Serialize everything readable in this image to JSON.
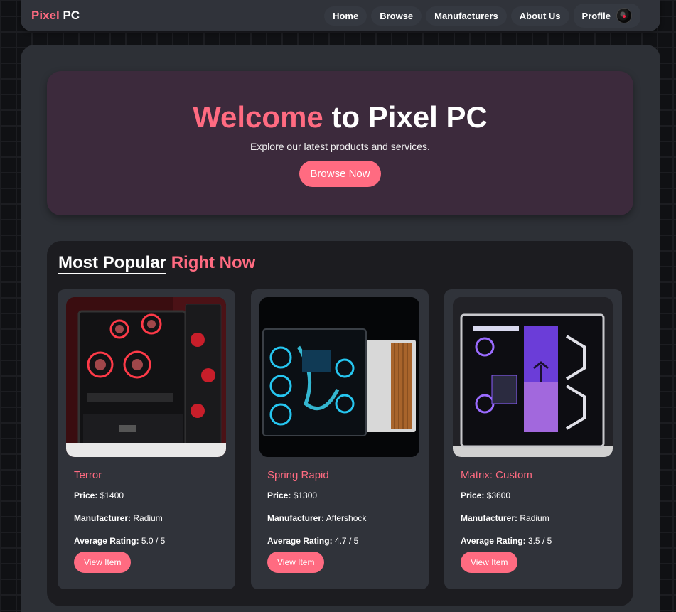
{
  "brand": {
    "part1": "Pixel",
    "part2": "PC"
  },
  "nav": {
    "links": [
      "Home",
      "Browse",
      "Manufacturers",
      "About Us"
    ],
    "profile_label": "Profile"
  },
  "hero": {
    "title_accent": "Welcome",
    "title_rest": " to Pixel PC",
    "subtitle": "Explore our latest products and services.",
    "cta": "Browse Now"
  },
  "popular": {
    "title_part1": "Most Popular",
    "title_part2": "Right Now",
    "cards": [
      {
        "name": "Terror",
        "price_label": "Price:",
        "price": "$1400",
        "manufacturer_label": "Manufacturer:",
        "manufacturer": "Radium",
        "rating_label": "Average Rating:",
        "rating": "5.0 / 5",
        "button": "View Item",
        "image_icon": "red-gaming-pc-image"
      },
      {
        "name": "Spring Rapid",
        "price_label": "Price:",
        "price": "$1300",
        "manufacturer_label": "Manufacturer:",
        "manufacturer": "Aftershock",
        "rating_label": "Average Rating:",
        "rating": "4.7 / 5",
        "button": "View Item",
        "image_icon": "blue-gaming-pc-image"
      },
      {
        "name": "Matrix: Custom",
        "price_label": "Price:",
        "price": "$3600",
        "manufacturer_label": "Manufacturer:",
        "manufacturer": "Radium",
        "rating_label": "Average Rating:",
        "rating": "3.5 / 5",
        "button": "View Item",
        "image_icon": "purple-gaming-pc-image"
      }
    ]
  },
  "colors": {
    "accent": "#ff6b81",
    "hero_bg": "#3c2a3c",
    "card_bg": "#30333a",
    "nav_bg": "#30333a"
  }
}
